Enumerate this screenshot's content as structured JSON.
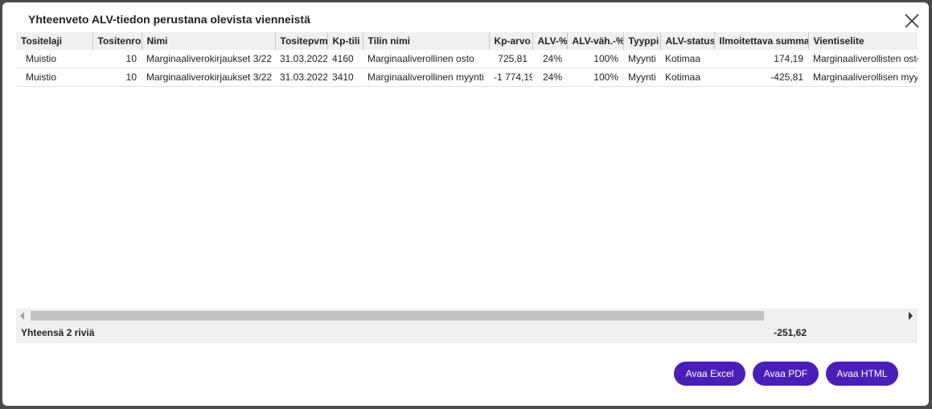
{
  "dialog": {
    "title": "Yhteenveto ALV-tiedon perustana olevista vienneistä"
  },
  "table": {
    "columns": [
      "Tositelaji",
      "Tositenro",
      "Nimi",
      "Tositepvm",
      "Kp-tili",
      "Tilin nimi",
      "Kp-arvo",
      "ALV-%",
      "ALV-väh.-%",
      "Tyyppi",
      "ALV-status",
      "Ilmoitettava summa",
      "Vientiselite"
    ],
    "rows": [
      [
        "Muistio",
        "10",
        "Marginaaliverokirjaukset 3/22",
        "31.03.2022",
        "4160",
        "Marginaaliverollinen osto",
        "725,81",
        "24%",
        "100%",
        "Myynti",
        "Kotimaa",
        "174,19",
        "Marginaaliverollisten osto"
      ],
      [
        "Muistio",
        "10",
        "Marginaaliverokirjaukset 3/22",
        "31.03.2022",
        "3410",
        "Marginaaliverollinen myynti",
        "-1 774,19",
        "24%",
        "100%",
        "Myynti",
        "Kotimaa",
        "-425,81",
        "Marginaaliverollisen myyn"
      ]
    ]
  },
  "footer": {
    "row_count": "Yhteensä 2 riviä",
    "total": "-251,62"
  },
  "buttons": {
    "excel": "Avaa Excel",
    "pdf": "Avaa PDF",
    "html": "Avaa HTML"
  },
  "colors": {
    "accent": "#4a1fb8",
    "header_bg": "#f0f0f0",
    "overlay": "#4a4a4a"
  }
}
